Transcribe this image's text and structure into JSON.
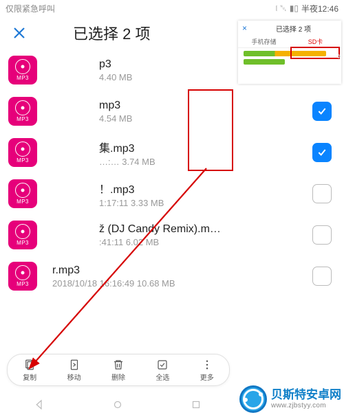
{
  "status": {
    "left": "仅限紧急呼叫",
    "wifi": "wifi-icon",
    "dnd": "dnd-icon",
    "batt": "battery-icon",
    "time": "半夜12:46"
  },
  "header": {
    "title": "已选择 2 项"
  },
  "files": [
    {
      "title": "p3",
      "sub": "4.40 MB",
      "checked": false
    },
    {
      "title": "mp3",
      "sub": "4.54 MB",
      "checked": true
    },
    {
      "title": "集.mp3",
      "sub": "…:…  3.74 MB",
      "checked": true
    },
    {
      "title": "！.mp3",
      "sub": "1:17:11 3.33 MB",
      "checked": false
    },
    {
      "title": "ž (DJ Candy Remix).m…",
      "sub": ":41:11 6.02 MB",
      "checked": false
    },
    {
      "title": "r.mp3",
      "sub": "2018/10/18 16:16:49 10.68 MB",
      "checked": false
    }
  ],
  "actions": [
    {
      "key": "copy",
      "label": "复制"
    },
    {
      "key": "move",
      "label": "移动"
    },
    {
      "key": "delete",
      "label": "删除"
    },
    {
      "key": "selectall",
      "label": "全选"
    },
    {
      "key": "more",
      "label": "更多"
    }
  ],
  "inset": {
    "title": "已选择 2 项",
    "tab1": "手机存储",
    "tab2": "SD卡"
  },
  "badge": "MP3",
  "logo": {
    "title": "贝斯特安卓网",
    "url": "www.zjbstyy.com"
  }
}
